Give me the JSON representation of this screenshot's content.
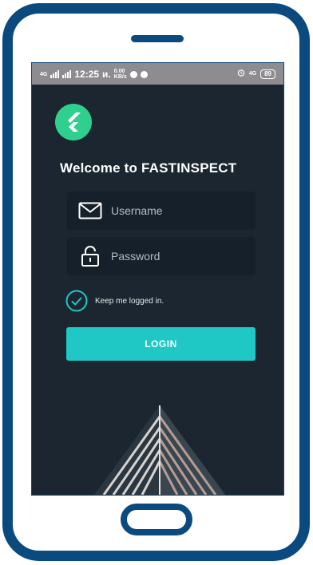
{
  "status_bar": {
    "network_left": "4G",
    "time": "12:25",
    "carrier": "ᴎ.",
    "speed_top": "0.00",
    "speed_bottom": "KB/s",
    "network_right": "4G",
    "battery": "89"
  },
  "login": {
    "welcome": "Welcome to FASTINSPECT",
    "username_placeholder": "Username",
    "password_placeholder": "Password",
    "remember_label": "Keep me logged in.",
    "login_button": "LOGIN"
  },
  "colors": {
    "frame": "#0b4a7e",
    "screen_bg": "#1b2630",
    "field_bg": "#16202a",
    "accent": "#1fc7c5",
    "logo": "#2fd08f"
  },
  "icons": {
    "logo": "flutter-logo",
    "username": "envelope-icon",
    "password": "lock-icon",
    "remember": "check-circle-icon"
  }
}
